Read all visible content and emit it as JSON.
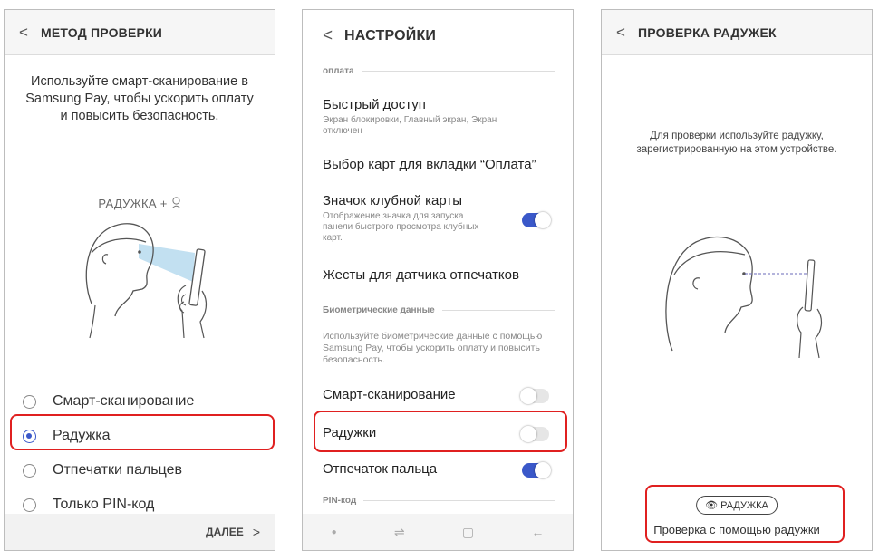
{
  "screen1": {
    "title": "МЕТОД ПРОВЕРКИ",
    "intro": "Используйте смарт-сканирование в Samsung Pay, чтобы ускорить оплату и повысить безопасность.",
    "illustration_caption": "РАДУЖКА + ",
    "options": [
      {
        "label": "Смарт-сканирование",
        "selected": false
      },
      {
        "label": "Радужка",
        "selected": true
      },
      {
        "label": "Отпечатки пальцев",
        "selected": false
      },
      {
        "label": "Только PIN-код",
        "selected": false
      }
    ],
    "next_label": "ДАЛЕЕ"
  },
  "screen2": {
    "title": "НАСТРОЙКИ",
    "section_payment": "оплата",
    "quick_access": {
      "title": "Быстрый доступ",
      "subtitle": "Экран блокировки, Главный экран, Экран отключен"
    },
    "card_selection": {
      "title": "Выбор карт для вкладки “Оплата”"
    },
    "club_card": {
      "title": "Значок клубной карты",
      "subtitle": "Отображение значка для запуска панели быстрого просмотра клубных карт.",
      "on": true
    },
    "gestures": {
      "title": "Жесты для датчика отпечатков"
    },
    "section_biometric": "Биометрические данные",
    "biometric_desc": "Используйте биометрические данные с помощью Samsung Pay, чтобы ускорить оплату и повысить безопасность.",
    "smart_scan": {
      "title": "Смарт-сканирование",
      "on": false
    },
    "iris": {
      "title": "Радужки",
      "on": false
    },
    "fingerprint": {
      "title": "Отпечаток пальца",
      "on": true
    },
    "section_pin": "PIN-код"
  },
  "screen3": {
    "title": "ПРОВЕРКА РАДУЖЕК",
    "instruction": "Для проверки используйте радужку, зарегистрированную на этом устройстве.",
    "iris_chip": "РАДУЖКА",
    "caption": "Проверка с помощью радужки"
  },
  "colors": {
    "accent": "#3a58c9",
    "highlight": "#e02020"
  }
}
